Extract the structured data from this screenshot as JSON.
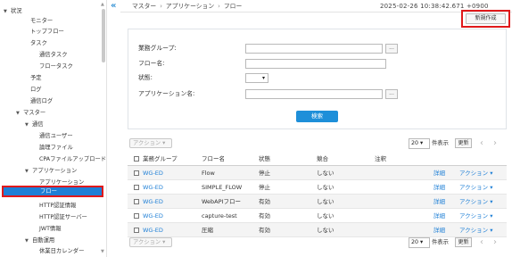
{
  "sidebar": {
    "collapse_icon": "«",
    "items": [
      {
        "label": "状況",
        "caret": "▼"
      },
      {
        "label": "モニター"
      },
      {
        "label": "トップフロー"
      },
      {
        "label": "タスク"
      },
      {
        "label": "通信タスク"
      },
      {
        "label": "フロータスク"
      },
      {
        "label": "予定"
      },
      {
        "label": "ログ"
      },
      {
        "label": "通信ログ"
      },
      {
        "label": "マスター",
        "caret": "▼"
      },
      {
        "label": "通信",
        "caret": "▼"
      },
      {
        "label": "通信ユーザー"
      },
      {
        "label": "論理ファイル"
      },
      {
        "label": "CPAファイルアップロード"
      },
      {
        "label": "アプリケーション",
        "caret": "▼"
      },
      {
        "label": "アプリケーション"
      },
      {
        "label": "フロー"
      },
      {
        "label": "HTTP認証情報"
      },
      {
        "label": "HTTP認証サーバー"
      },
      {
        "label": "JWT情報"
      },
      {
        "label": "自動運用",
        "caret": "▼"
      },
      {
        "label": "休業日カレンダー"
      }
    ],
    "selected_label": "フロー"
  },
  "header": {
    "breadcrumb": [
      "マスター",
      "アプリケーション",
      "フロー"
    ],
    "breadcrumb_sep": "›",
    "timestamp": "2025-02-26 10:38:42.671 +0900",
    "new_button_label": "新規作成"
  },
  "search": {
    "business_group_label": "業務グループ:",
    "flow_name_label": "フロー名:",
    "status_label": "状態:",
    "app_name_label": "アプリケーション名:",
    "lookup_label": "...",
    "select_arrow": "▾",
    "search_button_label": "検索"
  },
  "toolbar": {
    "action_label": "アクション ▾",
    "per_page_value": "20 ▾",
    "per_page_label": "件表示",
    "display_button_label": "更新",
    "prev": "‹",
    "next": "›"
  },
  "table": {
    "columns": [
      "業務グループ",
      "フロー名",
      "状態",
      "競合",
      "注釈"
    ],
    "rows": [
      {
        "group": "WG-ED",
        "flow": "Flow",
        "status": "停止",
        "conflict": "しない",
        "note": "",
        "detail": "詳細",
        "action": "アクション ▾"
      },
      {
        "group": "WG-ED",
        "flow": "SIMPLE_FLOW",
        "status": "停止",
        "conflict": "しない",
        "note": "",
        "detail": "詳細",
        "action": "アクション ▾"
      },
      {
        "group": "WG-ED",
        "flow": "WebAPIフロー",
        "status": "有効",
        "conflict": "しない",
        "note": "",
        "detail": "詳細",
        "action": "アクション ▾"
      },
      {
        "group": "WG-ED",
        "flow": "capture-test",
        "status": "有効",
        "conflict": "しない",
        "note": "",
        "detail": "詳細",
        "action": "アクション ▾"
      },
      {
        "group": "WG-ED",
        "flow": "圧縮",
        "status": "有効",
        "conflict": "しない",
        "note": "",
        "detail": "詳細",
        "action": "アクション ▾"
      }
    ]
  },
  "colors": {
    "accent": "#1e7fd6",
    "highlight_border": "#e0191b"
  }
}
